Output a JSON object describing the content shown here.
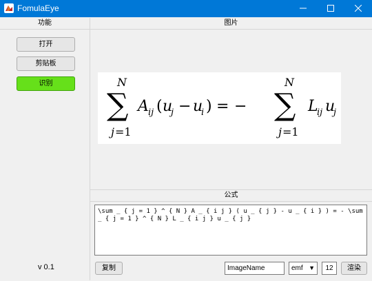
{
  "window": {
    "title": "FomulaEye",
    "controls": {
      "minimize": "—",
      "maximize": "☐",
      "close": "✕"
    }
  },
  "sidebar": {
    "header": "功能",
    "buttons": {
      "open": "打开",
      "clipboard": "剪贴板",
      "recognize": "识别"
    },
    "version": "v 0.1",
    "recognize_color": "#66e01a"
  },
  "image_panel": {
    "header": "图片"
  },
  "formula_panel": {
    "header": "公式",
    "latex": "\\sum _ { j = 1 } ^ { N } A _ { i j } ( u _ { j } - u _ { i } ) = - \\sum _ { j = 1 } ^ { N } L _ { i j } u _ { j }",
    "copy_label": "复制",
    "image_name": "ImageName",
    "format": "emf",
    "font_size": "12",
    "render_label": "渲染"
  },
  "colors": {
    "titlebar": "#0078d7",
    "background": "#f0f0f0"
  }
}
